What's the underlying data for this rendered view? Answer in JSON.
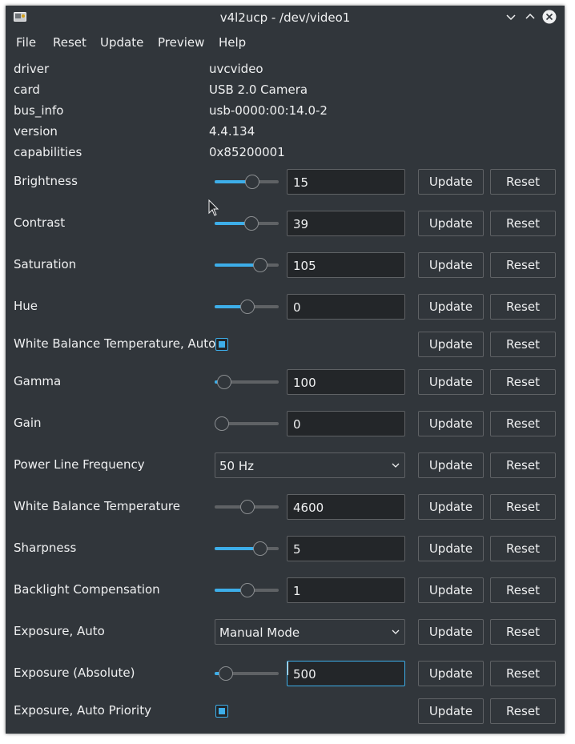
{
  "window": {
    "title": "v4l2ucp - /dev/video1"
  },
  "menu": [
    "File",
    "Reset",
    "Update",
    "Preview",
    "Help"
  ],
  "info": [
    {
      "key": "driver",
      "value": "uvcvideo"
    },
    {
      "key": "card",
      "value": "USB 2.0 Camera"
    },
    {
      "key": "bus_info",
      "value": "usb-0000:00:14.0-2"
    },
    {
      "key": "version",
      "value": "4.4.134"
    },
    {
      "key": "capabilities",
      "value": "0x85200001"
    }
  ],
  "buttons": {
    "update": "Update",
    "reset": "Reset"
  },
  "controls": [
    {
      "label": "Brightness",
      "type": "slider",
      "value": "15",
      "level": 0.6
    },
    {
      "label": "Contrast",
      "type": "slider",
      "value": "39",
      "level": 0.58
    },
    {
      "label": "Saturation",
      "type": "slider",
      "value": "105",
      "level": 0.75
    },
    {
      "label": "Hue",
      "type": "slider",
      "value": "0",
      "level": 0.5
    },
    {
      "label": "White Balance Temperature, Auto",
      "type": "checkbox",
      "checked": true
    },
    {
      "label": "Gamma",
      "type": "slider",
      "value": "100",
      "level": 0.05
    },
    {
      "label": "Gain",
      "type": "slider",
      "value": "0",
      "level": 0.0
    },
    {
      "label": "Power Line Frequency",
      "type": "combo",
      "value": "50 Hz"
    },
    {
      "label": "White Balance Temperature",
      "type": "slider",
      "value": "4600",
      "level": 0.5,
      "filled": false
    },
    {
      "label": "Sharpness",
      "type": "slider",
      "value": "5",
      "level": 0.75
    },
    {
      "label": "Backlight Compensation",
      "type": "slider",
      "value": "1",
      "level": 0.5
    },
    {
      "label": "Exposure, Auto",
      "type": "combo",
      "value": "Manual Mode"
    },
    {
      "label": "Exposure (Absolute)",
      "type": "slider",
      "value": "500",
      "level": 0.08,
      "focused": true
    },
    {
      "label": "Exposure, Auto Priority",
      "type": "checkbox",
      "checked": true
    }
  ],
  "colors": {
    "accent": "#3daee9",
    "background": "#31363b",
    "field": "#232629"
  }
}
